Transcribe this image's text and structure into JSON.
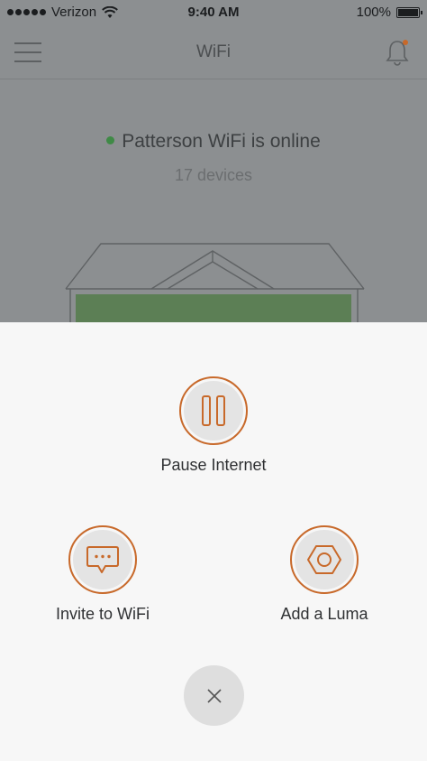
{
  "status_bar": {
    "carrier": "Verizon",
    "time": "9:40 AM",
    "battery": "100%",
    "battery_level": 1.0
  },
  "nav": {
    "title": "WiFi",
    "menu_icon": "hamburger-menu-icon",
    "bell_icon": "bell-icon",
    "notification_color": "#c8692a"
  },
  "network": {
    "status": "Patterson WiFi is online",
    "status_color": "#3f8a46",
    "devices": "17 devices"
  },
  "actions": {
    "pause": {
      "label": "Pause Internet",
      "icon": "pause-icon"
    },
    "invite": {
      "label": "Invite to WiFi",
      "icon": "chat-bubble-icon"
    },
    "add_luma": {
      "label": "Add a Luma",
      "icon": "hex-nut-icon"
    },
    "close_icon": "close-icon",
    "accent_color": "#c8692a"
  }
}
